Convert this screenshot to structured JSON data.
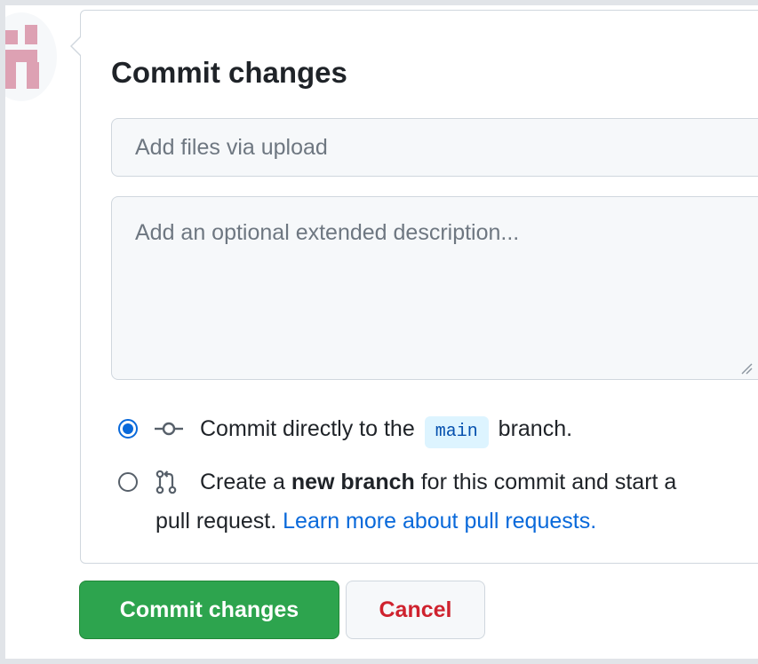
{
  "commit_form": {
    "title": "Commit changes",
    "summary_placeholder": "Add files via upload",
    "description_placeholder": "Add an optional extended description...",
    "option_direct": {
      "text_before": "Commit directly to the",
      "branch": "main",
      "text_after": "branch.",
      "selected": true,
      "icon": "git-commit-icon"
    },
    "option_new_branch": {
      "text_before": "Create a",
      "bold": "new branch",
      "text_after": "for this commit and start a",
      "text_line2": "pull request.",
      "link": "Learn more about pull requests.",
      "selected": false,
      "icon": "git-pull-request-icon"
    }
  },
  "actions": {
    "commit_label": "Commit changes",
    "cancel_label": "Cancel"
  },
  "colors": {
    "primary_button": "#2da44e",
    "danger_text": "#cf222e",
    "link": "#0969da",
    "border": "#d0d7de"
  }
}
